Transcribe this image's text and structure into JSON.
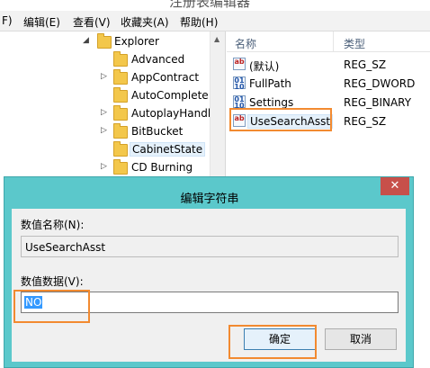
{
  "window": {
    "title": "注册表编辑器"
  },
  "menu": {
    "items": [
      {
        "label": "F)"
      },
      {
        "label": "编辑(E)"
      },
      {
        "label": "查看(V)"
      },
      {
        "label": "收藏夹(A)"
      },
      {
        "label": "帮助(H)"
      }
    ]
  },
  "tree": {
    "items": [
      {
        "label": "Explorer",
        "expanded": true
      },
      {
        "label": "Advanced"
      },
      {
        "label": "AppContract"
      },
      {
        "label": "AutoComplete"
      },
      {
        "label": "AutoplayHandl"
      },
      {
        "label": "BitBucket"
      },
      {
        "label": "CabinetState",
        "selected": true
      },
      {
        "label": "CD Burning"
      }
    ]
  },
  "values": {
    "columns": {
      "name": "名称",
      "type": "类型"
    },
    "rows": [
      {
        "name": "(默认)",
        "type": "REG_SZ",
        "icon": "string-value-icon"
      },
      {
        "name": "FullPath",
        "type": "REG_DWORD",
        "icon": "binary-value-icon"
      },
      {
        "name": "Settings",
        "type": "REG_BINARY",
        "icon": "binary-value-icon"
      },
      {
        "name": "UseSearchAsst",
        "type": "REG_SZ",
        "icon": "string-value-icon",
        "selected": true
      }
    ]
  },
  "dialog": {
    "title": "编辑字符串",
    "close_label": "✕",
    "name_label": "数值名称(N):",
    "name_value": "UseSearchAsst",
    "data_label": "数值数据(V):",
    "data_value": "NO",
    "ok_label": "确定",
    "cancel_label": "取消"
  },
  "colors": {
    "dialog_frame": "#5bc8cb",
    "close_button": "#c7504a",
    "annotation": "#f28a30",
    "selection": "#3399ff"
  }
}
